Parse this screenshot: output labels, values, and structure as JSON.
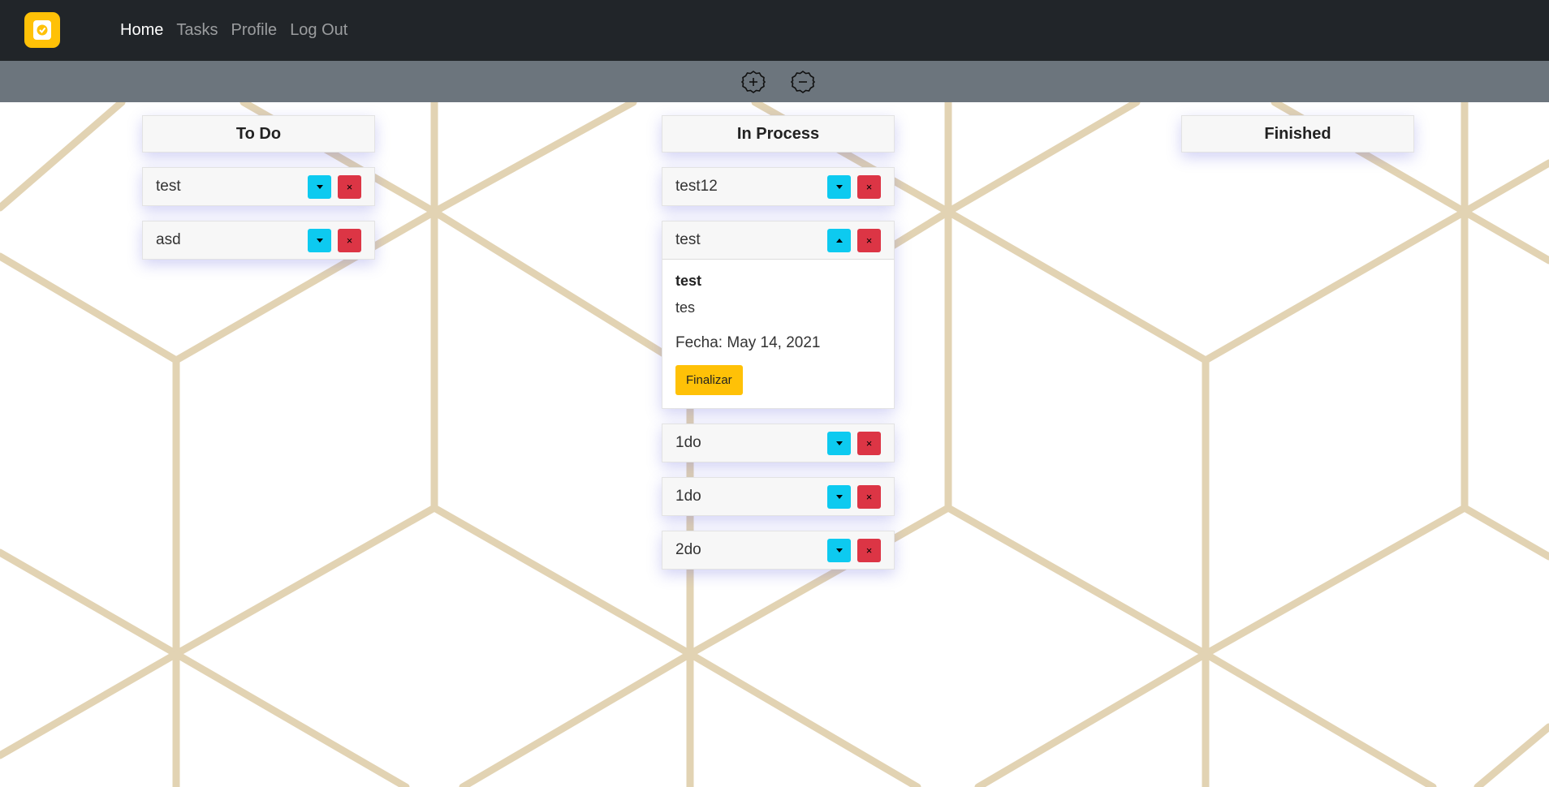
{
  "nav": {
    "links": [
      {
        "label": "Home",
        "active": true
      },
      {
        "label": "Tasks",
        "active": false
      },
      {
        "label": "Profile",
        "active": false
      },
      {
        "label": "Log Out",
        "active": false
      }
    ]
  },
  "toolbar": {
    "zoom_in_icon": "plus-circle-icon",
    "zoom_out_icon": "minus-circle-icon"
  },
  "colors": {
    "navbar": "#212529",
    "toolbar": "#6c757d",
    "brand": "#ffc107",
    "toggle_button": "#0dcaf0",
    "delete_button": "#dc3545",
    "finish_button": "#ffc107",
    "background_lines": "#e2d3b3"
  },
  "columns": [
    {
      "title": "To Do",
      "tasks": [
        {
          "title": "test",
          "delete_label": "×"
        },
        {
          "title": "asd",
          "delete_label": "×"
        }
      ]
    },
    {
      "title": "In Process",
      "tasks": [
        {
          "title": "test12",
          "delete_label": "×"
        },
        {
          "title": "test",
          "delete_label": "×",
          "expanded": true,
          "detail_title": "test",
          "detail_desc": "tes",
          "detail_date": "Fecha: May 14, 2021",
          "finish_label": "Finalizar"
        },
        {
          "title": "1do",
          "delete_label": "×"
        },
        {
          "title": "1do",
          "delete_label": "×"
        },
        {
          "title": "2do",
          "delete_label": "×"
        }
      ]
    },
    {
      "title": "Finished",
      "tasks": []
    }
  ]
}
